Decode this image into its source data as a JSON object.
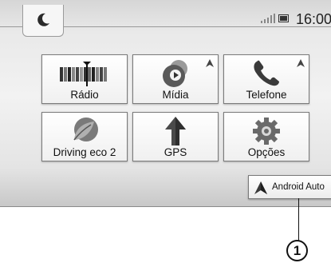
{
  "status_bar": {
    "time": "16:00",
    "icons": [
      "moon-icon",
      "signal-icon",
      "battery-icon"
    ]
  },
  "tiles": [
    {
      "label": "Rádio",
      "icon": "radio-icon",
      "android_auto_badge": false
    },
    {
      "label": "Mídia",
      "icon": "media-play-icon",
      "android_auto_badge": true
    },
    {
      "label": "Telefone",
      "icon": "phone-icon",
      "android_auto_badge": true
    },
    {
      "label": "Driving eco 2",
      "icon": "eco-leaf-icon",
      "android_auto_badge": false
    },
    {
      "label": "GPS",
      "icon": "gps-arrow-icon",
      "android_auto_badge": false
    },
    {
      "label": "Opções",
      "icon": "gear-icon",
      "android_auto_badge": false
    }
  ],
  "android_auto_button": {
    "label": "Android Auto",
    "icon": "android-auto-icon"
  },
  "callout": {
    "number": "1"
  },
  "colors": {
    "background": "#e9e9e9",
    "tile": "#ffffff",
    "border": "#7a7a7a",
    "badge": "#444444"
  }
}
